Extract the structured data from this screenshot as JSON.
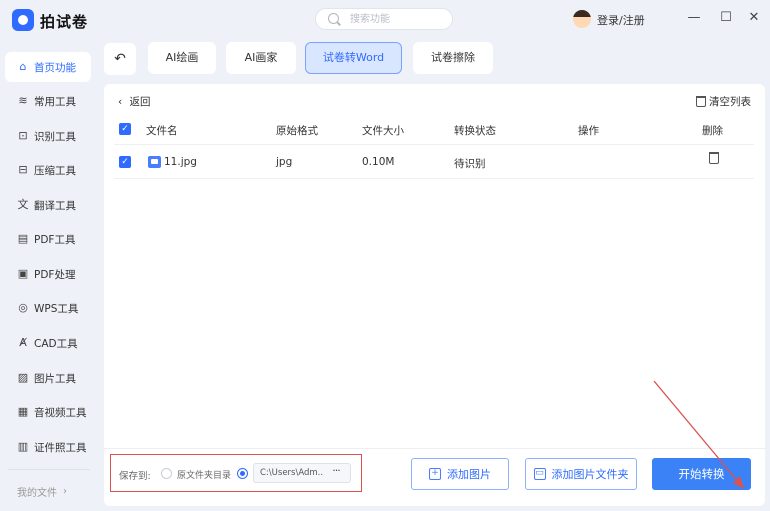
{
  "app": {
    "title": "拍试卷",
    "brand_color": "#2f6bff"
  },
  "titlebar": {
    "search_placeholder": "搜索功能",
    "login_label": "登录/注册",
    "minimize_glyph": "—",
    "maximize_glyph": "☐",
    "close_glyph": "✕"
  },
  "sidebar": {
    "items": [
      {
        "label": "首页功能",
        "icon": "home-icon",
        "glyph": "⌂",
        "active": true
      },
      {
        "label": "常用工具",
        "icon": "layers-icon",
        "glyph": "≋"
      },
      {
        "label": "识别工具",
        "icon": "scan-icon",
        "glyph": "⊡"
      },
      {
        "label": "压缩工具",
        "icon": "compress-icon",
        "glyph": "⊟"
      },
      {
        "label": "翻译工具",
        "icon": "translate-icon",
        "glyph": "文"
      },
      {
        "label": "PDF工具",
        "icon": "pdf-icon",
        "glyph": "▤"
      },
      {
        "label": "PDF处理",
        "icon": "pdf-process-icon",
        "glyph": "▣"
      },
      {
        "label": "WPS工具",
        "icon": "wps-icon",
        "glyph": "◎"
      },
      {
        "label": "CAD工具",
        "icon": "cad-icon",
        "glyph": "Ⱥ"
      },
      {
        "label": "图片工具",
        "icon": "image-icon",
        "glyph": "▨"
      },
      {
        "label": "音视频工具",
        "icon": "media-icon",
        "glyph": "▦"
      },
      {
        "label": "证件照工具",
        "icon": "id-photo-icon",
        "glyph": "▥"
      }
    ],
    "my_files": "我的文件",
    "my_files_chevron": "›"
  },
  "tabs": {
    "back_glyph": "↶",
    "items": [
      {
        "label": "AI绘画"
      },
      {
        "label": "AI画家"
      },
      {
        "label": "试卷转Word",
        "active": true
      },
      {
        "label": "试卷擦除"
      }
    ]
  },
  "panel": {
    "return_label": "返回",
    "return_chevron": "‹",
    "clear_label": "清空列表",
    "headers": {
      "check": "✓",
      "filename": "文件名",
      "format": "原始格式",
      "size": "文件大小",
      "status": "转换状态",
      "action": "操作",
      "delete": "删除"
    },
    "rows": [
      {
        "check": "✓",
        "filename": "11.jpg",
        "format": "jpg",
        "size": "0.10M",
        "status": "待识别"
      }
    ]
  },
  "bottom": {
    "save_to": "保存到:",
    "option_source": "原文件夹目录",
    "path_value": "C:\\Users\\Adm...",
    "more": "···",
    "add_image": "添加图片",
    "add_folder": "添加图片文件夹",
    "start": "开始转换",
    "add_image_glyph": "+",
    "add_folder_glyph": "▭"
  },
  "annotation": {
    "color": "#d9534f"
  }
}
